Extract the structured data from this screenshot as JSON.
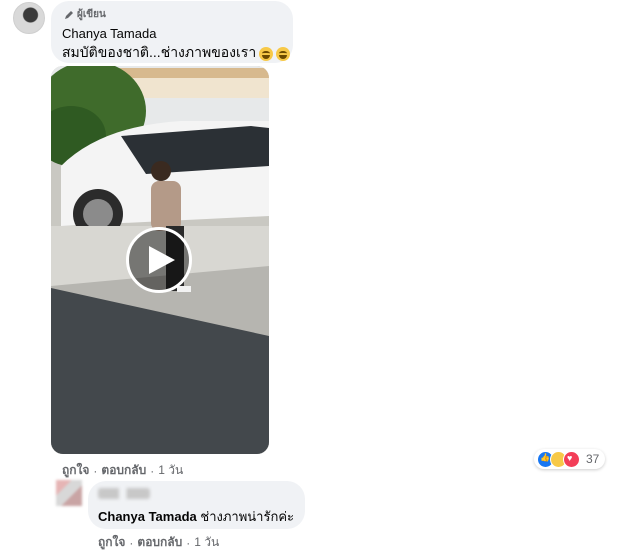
{
  "comment": {
    "author_badge": "ผู้เขียน",
    "author_name": "Chanya Tamada",
    "text": "สมบัติของชาติ...ช่างภาพของเรา",
    "actions": {
      "like": "ถูกใจ",
      "reply": "ตอบกลับ",
      "separator": "·",
      "time": "1 วัน"
    },
    "reactions": {
      "icons": [
        "like-icon",
        "haha-icon",
        "love-icon"
      ],
      "count": "37"
    }
  },
  "video": {
    "play_icon": "play-icon"
  },
  "reply": {
    "mention": "Chanya Tamada",
    "text": "ช่างภาพน่ารักค่ะ",
    "actions": {
      "like": "ถูกใจ",
      "reply": "ตอบกลับ",
      "separator": "·",
      "time": "1 วัน"
    }
  }
}
